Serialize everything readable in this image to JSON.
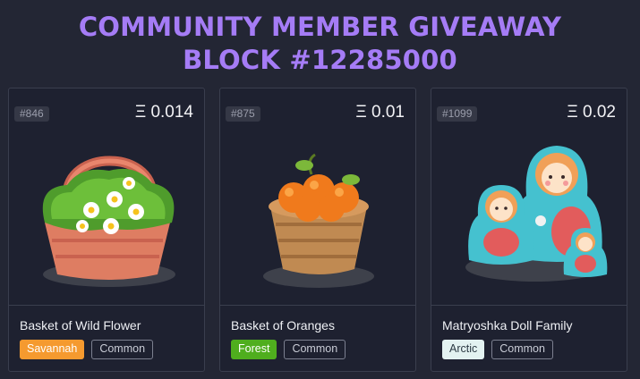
{
  "header": {
    "line1": "COMMUNITY MEMBER GIVEAWAY",
    "line2": "BLOCK #12285000",
    "accent_color": "#a57cf6"
  },
  "items": [
    {
      "id": "#846",
      "price": "Ξ 0.014",
      "name": "Basket of Wild Flower",
      "biome": "Savannah",
      "biome_color": "#f59a2f",
      "rarity": "Common",
      "icon": "flower-basket-icon"
    },
    {
      "id": "#875",
      "price": "Ξ 0.01",
      "name": "Basket of Oranges",
      "biome": "Forest",
      "biome_color": "#4fae1e",
      "rarity": "Common",
      "icon": "orange-basket-icon"
    },
    {
      "id": "#1099",
      "price": "Ξ 0.02",
      "name": "Matryoshka Doll Family",
      "biome": "Arctic",
      "biome_color": "#e3f2f1",
      "rarity": "Common",
      "icon": "matryoshka-dolls-icon"
    }
  ]
}
